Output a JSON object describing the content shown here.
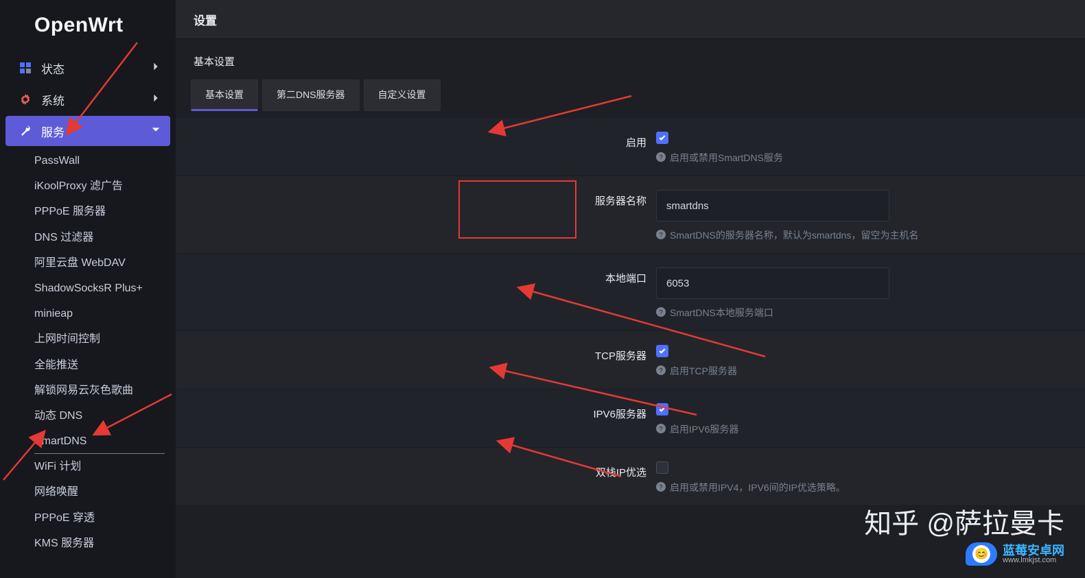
{
  "brand": "OpenWrt",
  "sidebar": {
    "status": {
      "label": "状态"
    },
    "system": {
      "label": "系统"
    },
    "services": {
      "label": "服务"
    },
    "items": [
      {
        "label": "PassWall"
      },
      {
        "label": "iKoolProxy 滤广告"
      },
      {
        "label": "PPPoE 服务器"
      },
      {
        "label": "DNS 过滤器"
      },
      {
        "label": "阿里云盘 WebDAV"
      },
      {
        "label": "ShadowSocksR Plus+"
      },
      {
        "label": "minieap"
      },
      {
        "label": "上网时间控制"
      },
      {
        "label": "全能推送"
      },
      {
        "label": "解锁网易云灰色歌曲"
      },
      {
        "label": "动态 DNS"
      },
      {
        "label": "SmartDNS"
      },
      {
        "label": "WiFi 计划"
      },
      {
        "label": "网络唤醒"
      },
      {
        "label": "PPPoE 穿透"
      },
      {
        "label": "KMS 服务器"
      }
    ]
  },
  "main": {
    "page_title": "设置",
    "section_title": "基本设置",
    "tabs": [
      {
        "label": "基本设置"
      },
      {
        "label": "第二DNS服务器"
      },
      {
        "label": "自定义设置"
      }
    ],
    "fields": {
      "enable": {
        "label": "启用",
        "checked": true,
        "hint": "启用或禁用SmartDNS服务"
      },
      "server_name": {
        "label": "服务器名称",
        "value": "smartdns",
        "hint": "SmartDNS的服务器名称，默认为smartdns，留空为主机名"
      },
      "local_port": {
        "label": "本地端口",
        "value": "6053",
        "hint": "SmartDNS本地服务端口"
      },
      "tcp_server": {
        "label": "TCP服务器",
        "checked": true,
        "hint": "启用TCP服务器"
      },
      "ipv6_server": {
        "label": "IPV6服务器",
        "checked": true,
        "hint": "启用IPV6服务器"
      },
      "dual_ip": {
        "label": "双栈IP优选",
        "checked": false,
        "hint": "启用或禁用IPV4，IPV6间的IP优选策略。"
      }
    }
  },
  "watermark": {
    "line1": "知乎 @萨拉曼卡",
    "brand": "蓝莓安卓网",
    "site": "www.lmkjst.com",
    "face": "😊"
  }
}
